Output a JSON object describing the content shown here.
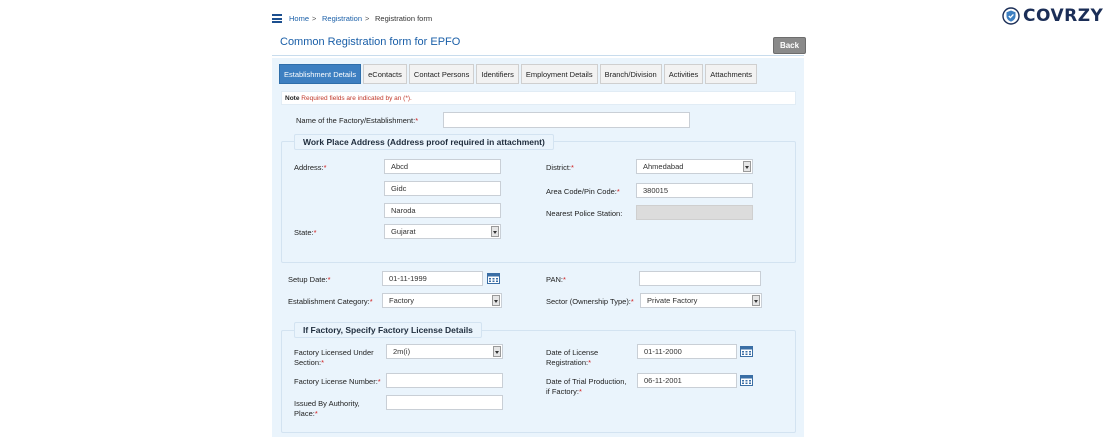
{
  "breadcrumb": {
    "home": "Home",
    "registration": "Registration",
    "current": "Registration form",
    "separator": ">"
  },
  "brand": {
    "name": "COVRZY"
  },
  "page": {
    "title": "Common Registration form for EPFO",
    "back_label": "Back"
  },
  "tabs": [
    {
      "label": "Establishment Details",
      "active": true
    },
    {
      "label": "eContacts",
      "active": false
    },
    {
      "label": "Contact Persons",
      "active": false
    },
    {
      "label": "Identifiers",
      "active": false
    },
    {
      "label": "Employment Details",
      "active": false
    },
    {
      "label": "Branch/Division",
      "active": false
    },
    {
      "label": "Activities",
      "active": false
    },
    {
      "label": "Attachments",
      "active": false
    }
  ],
  "note": {
    "label": "Note",
    "text": "Required fields are indicated by an (*)."
  },
  "form": {
    "req_mark": "*",
    "name_label": "Name of the Factory/Establishment:",
    "name_value": "",
    "workplace": {
      "legend": "Work Place Address (Address proof required in attachment)",
      "address_label": "Address:",
      "address_line1": "Abcd",
      "address_line2": "Gidc",
      "address_line3": "Naroda",
      "state_label": "State:",
      "state_value": "Gujarat",
      "district_label": "District:",
      "district_value": "Ahmedabad",
      "pin_label": "Area Code/Pin Code:",
      "pin_value": "380015",
      "police_label": "Nearest Police Station:",
      "police_value": ""
    },
    "setup_date_label": "Setup Date:",
    "setup_date_value": "01-11-1999",
    "pan_label": "PAN:",
    "pan_value": "",
    "category_label": "Establishment Category:",
    "category_value": "Factory",
    "sector_label": "Sector (Ownership Type):",
    "sector_value": "Private Factory",
    "factory": {
      "legend": "If Factory, Specify Factory License Details",
      "section_label_1": "Factory Licensed Under",
      "section_label_2": "Section:",
      "section_value": "2m(i)",
      "license_date_label_1": "Date of License",
      "license_date_label_2": "Registration:",
      "license_date_value": "01-11-2000",
      "license_no_label": "Factory License Number:",
      "license_no_value": "",
      "trial_label_1": "Date of Trial Production,",
      "trial_label_2": "if Factory:",
      "trial_value": "06-11-2001",
      "authority_label_1": "Issued By Authority,",
      "authority_label_2": "Place:",
      "authority_value": ""
    }
  },
  "colors": {
    "accent": "#1a5fa8",
    "tab_active": "#3d7fc1",
    "panel": "#eaf4fc",
    "required": "#d01c1c",
    "brand": "#1b2e57"
  }
}
